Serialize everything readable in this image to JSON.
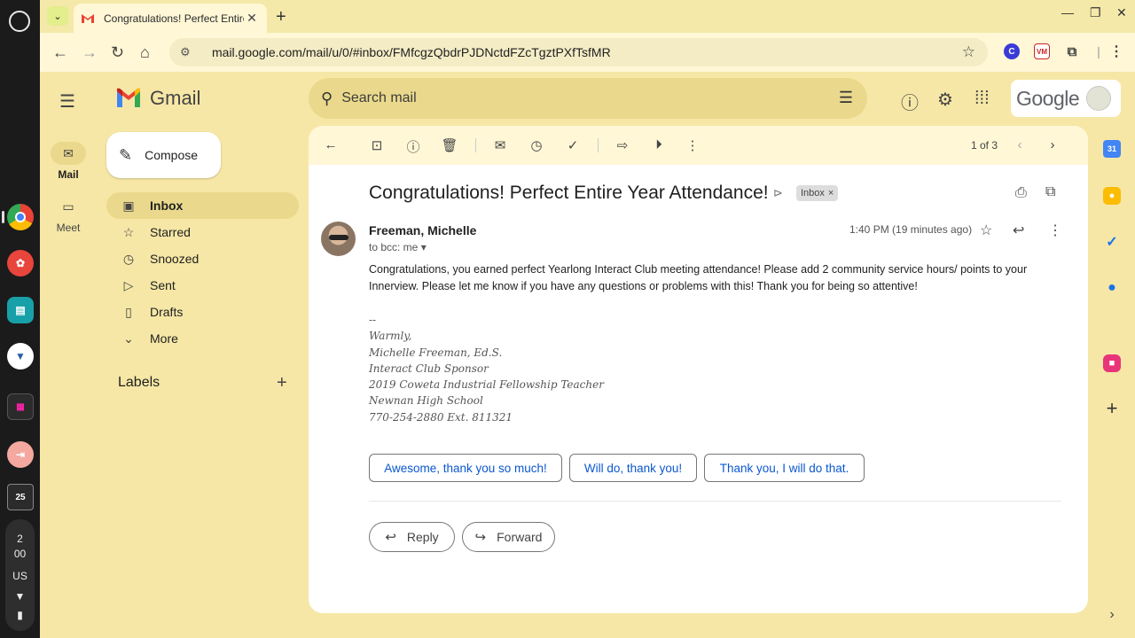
{
  "shelf": {
    "time_hour": "2",
    "time_min": "00",
    "locale": "US"
  },
  "browser": {
    "tab_title": "Congratulations! Perfect Entire",
    "url": "mail.google.com/mail/u/0/#inbox/FMfcgzQbdrPJDNctdFZcTgztPXfTsfMR",
    "ext_c": "C",
    "ext_vm": "VM"
  },
  "gmail": {
    "brand": "Gmail",
    "search_placeholder": "Search mail",
    "google_word": "Google",
    "rail": [
      {
        "label": "Mail"
      },
      {
        "label": "Meet"
      }
    ],
    "compose_label": "Compose",
    "nav": [
      {
        "label": "Inbox",
        "icon": "inbox-icon"
      },
      {
        "label": "Starred",
        "icon": "star-icon"
      },
      {
        "label": "Snoozed",
        "icon": "clock-icon"
      },
      {
        "label": "Sent",
        "icon": "send-icon"
      },
      {
        "label": "Drafts",
        "icon": "draft-icon"
      },
      {
        "label": "More",
        "icon": "chevron-down-icon"
      }
    ],
    "labels_heading": "Labels"
  },
  "message": {
    "pager": "1 of 3",
    "subject": "Congratulations! Perfect Entire Year Attendance!",
    "label_chip": "Inbox",
    "sender": "Freeman, Michelle",
    "to_line": "to bcc: me",
    "time": "1:40 PM (19 minutes ago)",
    "body_line1": "Congratulations, you earned perfect Yearlong Interact Club meeting attendance!  Please add 2 community service hours/ points to your",
    "body_line2": "Innerview.  Please let  me know if you have any questions or problems with this! Thank you for being so attentive!",
    "sig_dashes": "--",
    "sig": [
      "Warmly,",
      "Michelle Freeman, Ed.S.",
      "Interact Club Sponsor",
      "2019 Coweta Industrial Fellowship Teacher",
      "Newnan High School",
      "770-254-2880 Ext. 811321"
    ],
    "smart_replies": [
      "Awesome, thank you so much!",
      "Will do, thank you!",
      "Thank you, I will do that."
    ],
    "reply_label": "Reply",
    "forward_label": "Forward"
  },
  "colors": {
    "theme_bg": "#f6e7a6",
    "accent_blue": "#0b57d0"
  }
}
